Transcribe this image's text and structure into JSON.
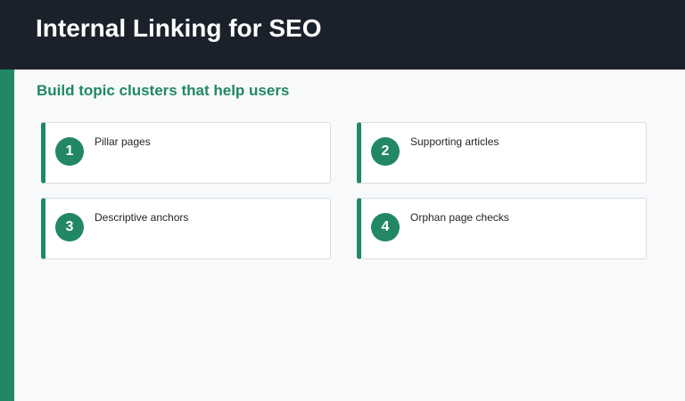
{
  "header": {
    "title": "Internal Linking for SEO"
  },
  "main": {
    "subtitle": "Build topic clusters that help users",
    "cards": [
      {
        "number": "1",
        "label": "Pillar pages"
      },
      {
        "number": "2",
        "label": "Supporting articles"
      },
      {
        "number": "3",
        "label": "Descriptive anchors"
      },
      {
        "number": "4",
        "label": "Orphan page checks"
      }
    ]
  },
  "colors": {
    "header_bg": "#1b212a",
    "accent": "#228766",
    "page_bg": "#f7f9fb"
  }
}
